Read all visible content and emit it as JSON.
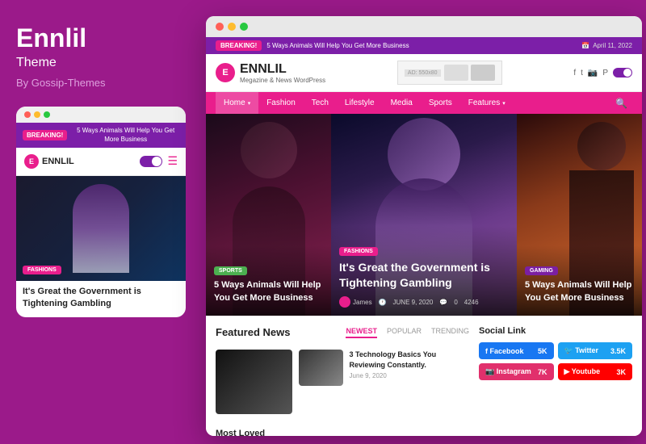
{
  "left": {
    "title": "Ennlil",
    "subtitle": "Theme",
    "by": "By Gossip-Themes",
    "dots": [
      "red",
      "yellow",
      "green"
    ],
    "breaking_badge": "BREAKING!",
    "breaking_text": "5 Ways Animals Will Help You Get More Business",
    "logo_letter": "E",
    "logo_name": "ENNLIL",
    "mobile_category": "FASHIONS",
    "mobile_article_title": "It's Great the Government is Tightening Gambling"
  },
  "browser": {
    "breaking_badge": "BREAKING!",
    "breaking_text": "5 Ways Animals Will Help You Get More Business",
    "date_icon": "📅",
    "date": "April 11, 2022",
    "logo_letter": "E",
    "logo_name": "ENNLIL",
    "logo_tagline": "Megazine & News WordPress",
    "ad_label": "AD: 550x80",
    "nav": {
      "items": [
        "Home",
        "Fashion",
        "Tech",
        "Lifestyle",
        "Media",
        "Sports",
        "Features"
      ],
      "home_chevron": "▾",
      "features_chevron": "▾",
      "search_icon": "🔍"
    },
    "articles": [
      {
        "category": "SPORTS",
        "category_class": "badge-sports",
        "headline": "5 Ways Animals Will Help You Get More Business",
        "col": "left"
      },
      {
        "category": "FASHIONS",
        "category_class": "badge-fashions",
        "headline": "It's Great the Government is Tightening Gambling",
        "author": "James",
        "date": "JUNE 9, 2020",
        "comments": "0",
        "views": "4246",
        "col": "center"
      },
      {
        "category": "GAMING",
        "category_class": "badge-gaming",
        "headline": "5 Ways Animals Will Help You Get More Business",
        "col": "right"
      }
    ],
    "featured": {
      "title": "Featured News",
      "tabs": [
        "NEWEST",
        "POPULAR",
        "TRENDING"
      ],
      "active_tab": "NEWEST",
      "articles": [
        {
          "title": "3 Technology Basics You Reviewing Constantly.",
          "date": "June 9, 2020"
        }
      ]
    },
    "social_link": {
      "title": "Social Link",
      "items": [
        {
          "name": "Facebook",
          "count": "5K",
          "class": "sl-facebook"
        },
        {
          "name": "Twitter",
          "count": "3.5K",
          "class": "sl-twitter"
        },
        {
          "name": "Instagram",
          "count": "7K",
          "class": "sl-instagram"
        },
        {
          "name": "Youtube",
          "count": "3K",
          "class": "sl-youtube"
        }
      ]
    },
    "most_loved": {
      "title": "Most Loved"
    }
  }
}
